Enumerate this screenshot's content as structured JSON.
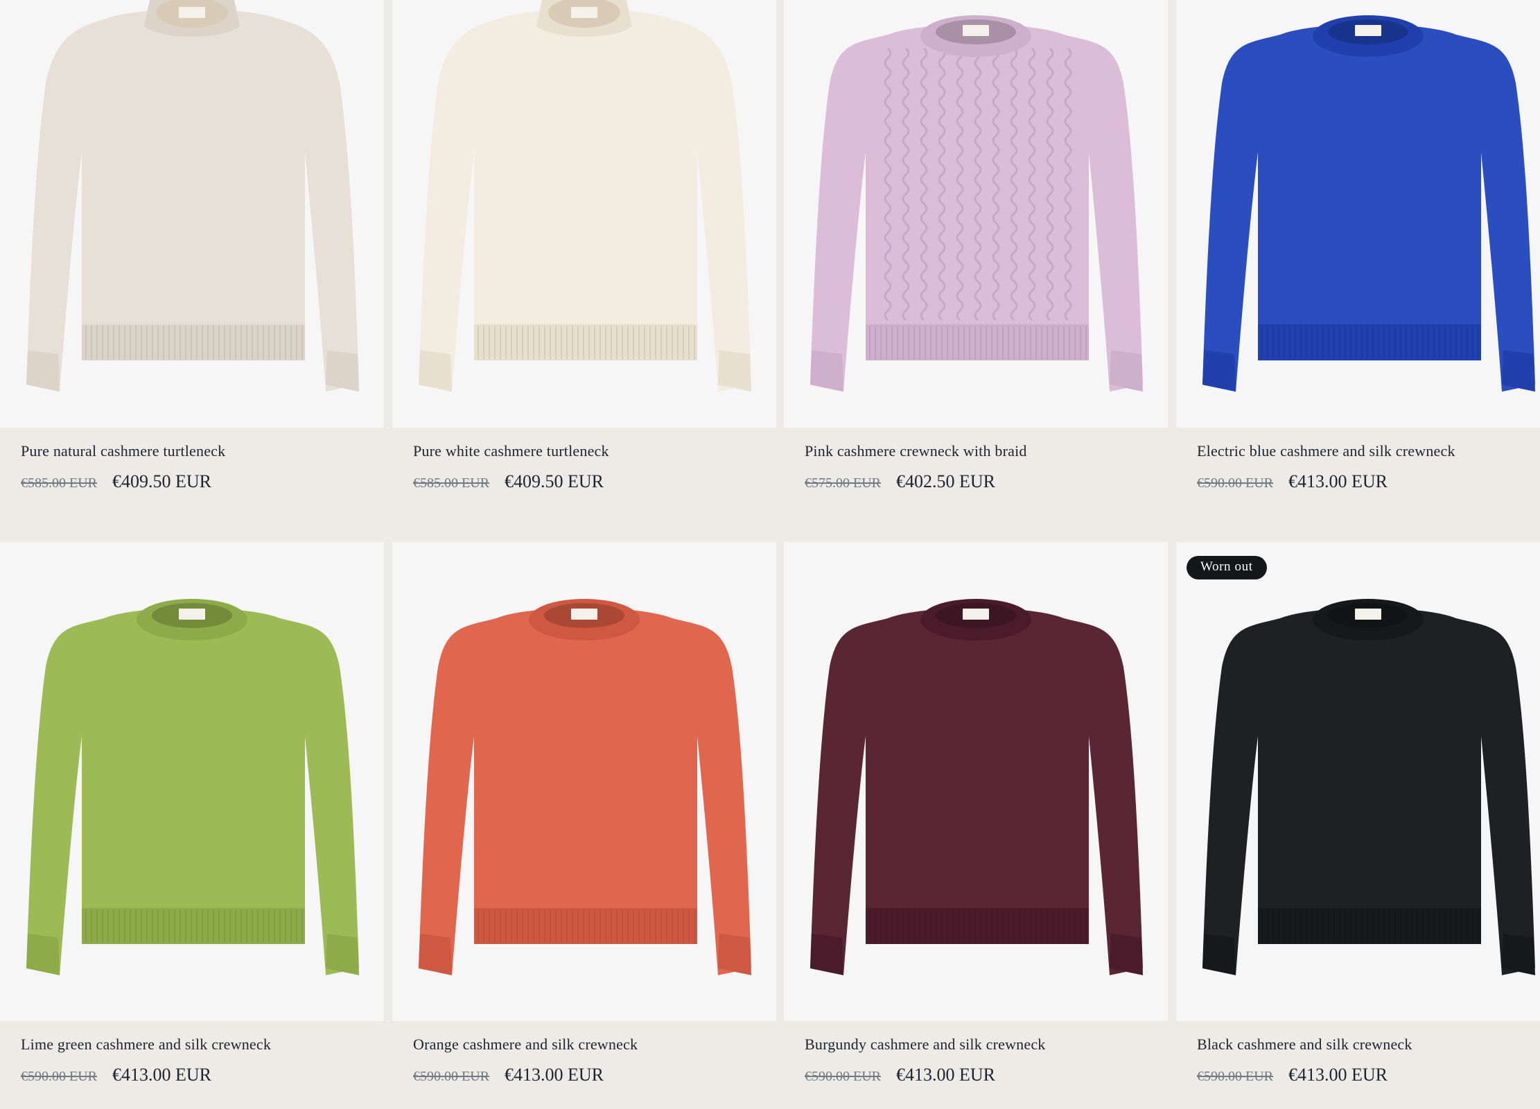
{
  "products": [
    {
      "name": "Pure natural cashmere turtleneck",
      "old_price": "€585.00 EUR",
      "price": "€409.50 EUR",
      "color": "#e7e0d7",
      "rib": "#dcd4c8",
      "style": "turtleneck",
      "badge": ""
    },
    {
      "name": "Pure white cashmere turtleneck",
      "old_price": "€585.00 EUR",
      "price": "€409.50 EUR",
      "color": "#f3ece0",
      "rib": "#e8dfcf",
      "style": "turtleneck",
      "badge": ""
    },
    {
      "name": "Pink cashmere crewneck with braid",
      "old_price": "€575.00 EUR",
      "price": "€402.50 EUR",
      "color": "#dbbdd8",
      "rib": "#cfb0cc",
      "style": "cable",
      "badge": ""
    },
    {
      "name": "Electric blue cashmere and silk crewneck",
      "old_price": "€590.00 EUR",
      "price": "€413.00 EUR",
      "color": "#2a4ec0",
      "rib": "#1f40ad",
      "style": "crewneck",
      "badge": ""
    },
    {
      "name": "Lime green cashmere and silk crewneck",
      "old_price": "€590.00 EUR",
      "price": "€413.00 EUR",
      "color": "#9dbb55",
      "rib": "#8dab48",
      "style": "crewneck",
      "badge": ""
    },
    {
      "name": "Orange cashmere and silk crewneck",
      "old_price": "€590.00 EUR",
      "price": "€413.00 EUR",
      "color": "#e0674d",
      "rib": "#cf5841",
      "style": "crewneck",
      "badge": ""
    },
    {
      "name": "Burgundy cashmere and silk crewneck",
      "old_price": "€590.00 EUR",
      "price": "€413.00 EUR",
      "color": "#5a2535",
      "rib": "#4a1c2b",
      "style": "crewneck",
      "badge": ""
    },
    {
      "name": "Black cashmere and silk crewneck",
      "old_price": "€590.00 EUR",
      "price": "€413.00 EUR",
      "color": "#1f2024",
      "rib": "#17181b",
      "style": "crewneck",
      "badge": "Worn out"
    }
  ]
}
